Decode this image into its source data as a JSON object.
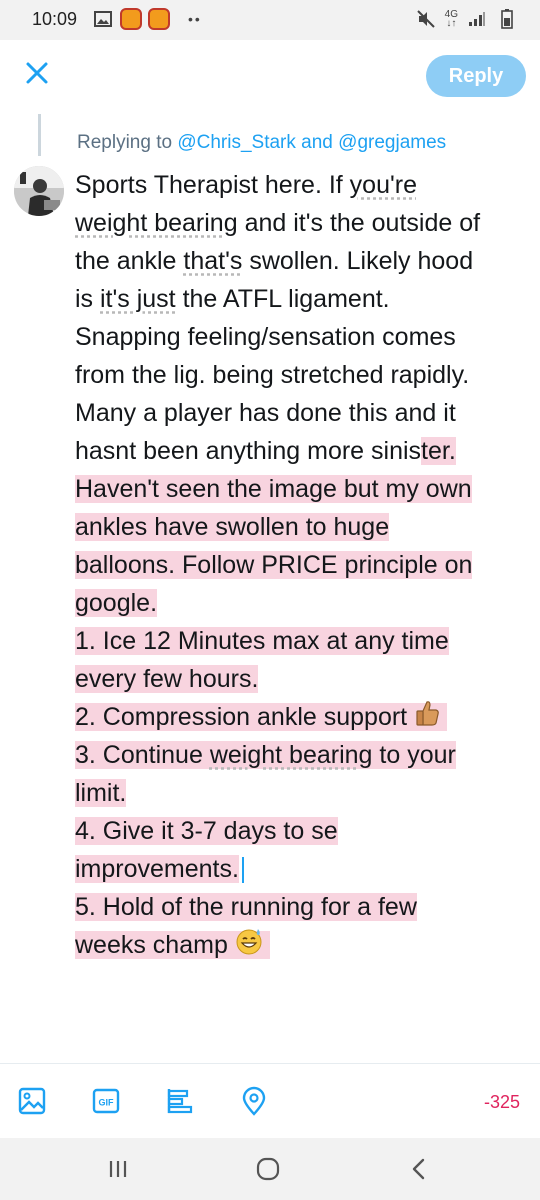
{
  "status_bar": {
    "time": "10:09",
    "network": "4G",
    "icons": [
      "gallery-icon",
      "app-notification-icon",
      "app-notification-icon",
      "more-dots",
      "mute-icon",
      "signal-icon",
      "battery-icon"
    ]
  },
  "header": {
    "close_icon": "close-icon",
    "reply_label": "Reply",
    "colors": {
      "accent": "#1da1f2",
      "reply_button_bg": "#8ecdf5"
    }
  },
  "replying": {
    "prefix": "Replying to ",
    "user1": "@Chris_Stark",
    "conjunction": " and ",
    "user2": "@gregjames"
  },
  "tweet": {
    "l1": "Sports Therapist here. If ",
    "l1_u": "you're",
    "l2_u": "weight bearing",
    "l2_b": " and it's the outside of",
    "l3_a": "the ankle ",
    "l3_u": "that's",
    "l3_b": " swollen. Likely hood",
    "l4_a": "is ",
    "l4_u": "it's just",
    "l4_b": " the ATFL ligament.",
    "l5": "Snapping feeling/sensation comes",
    "l6": "from the lig. being stretched rapidly.",
    "l7": "Many a player has done this and it",
    "l8_a": "hasnt been anything more sinis",
    "l8_b": "ter.",
    "l9": "Haven't seen the image but my own",
    "l10": "ankles have swollen to huge",
    "l11": "balloons. Follow PRICE principle on",
    "l12": "google.",
    "l13": "1. Ice 12 Minutes max at any time",
    "l14": "every few hours.",
    "l15": "2. Compression ankle support",
    "l16_a": "3. Continue ",
    "l16_u": "weight bearing",
    "l16_b": " to your",
    "l17": "limit.",
    "l18": "4. Give it 3-7 days to se",
    "l19": "improvements.",
    "l20": "5. Hold of the running for a few",
    "l21": "weeks champ",
    "highlight_color": "#f8d4df"
  },
  "toolbar": {
    "icons": [
      "image-icon",
      "gif-icon",
      "poll-icon",
      "location-icon"
    ],
    "gif_label": "GIF",
    "char_count": "-325",
    "char_count_color": "#e0245e"
  },
  "nav": {
    "icons": [
      "recent-apps-icon",
      "home-icon",
      "back-icon"
    ]
  }
}
